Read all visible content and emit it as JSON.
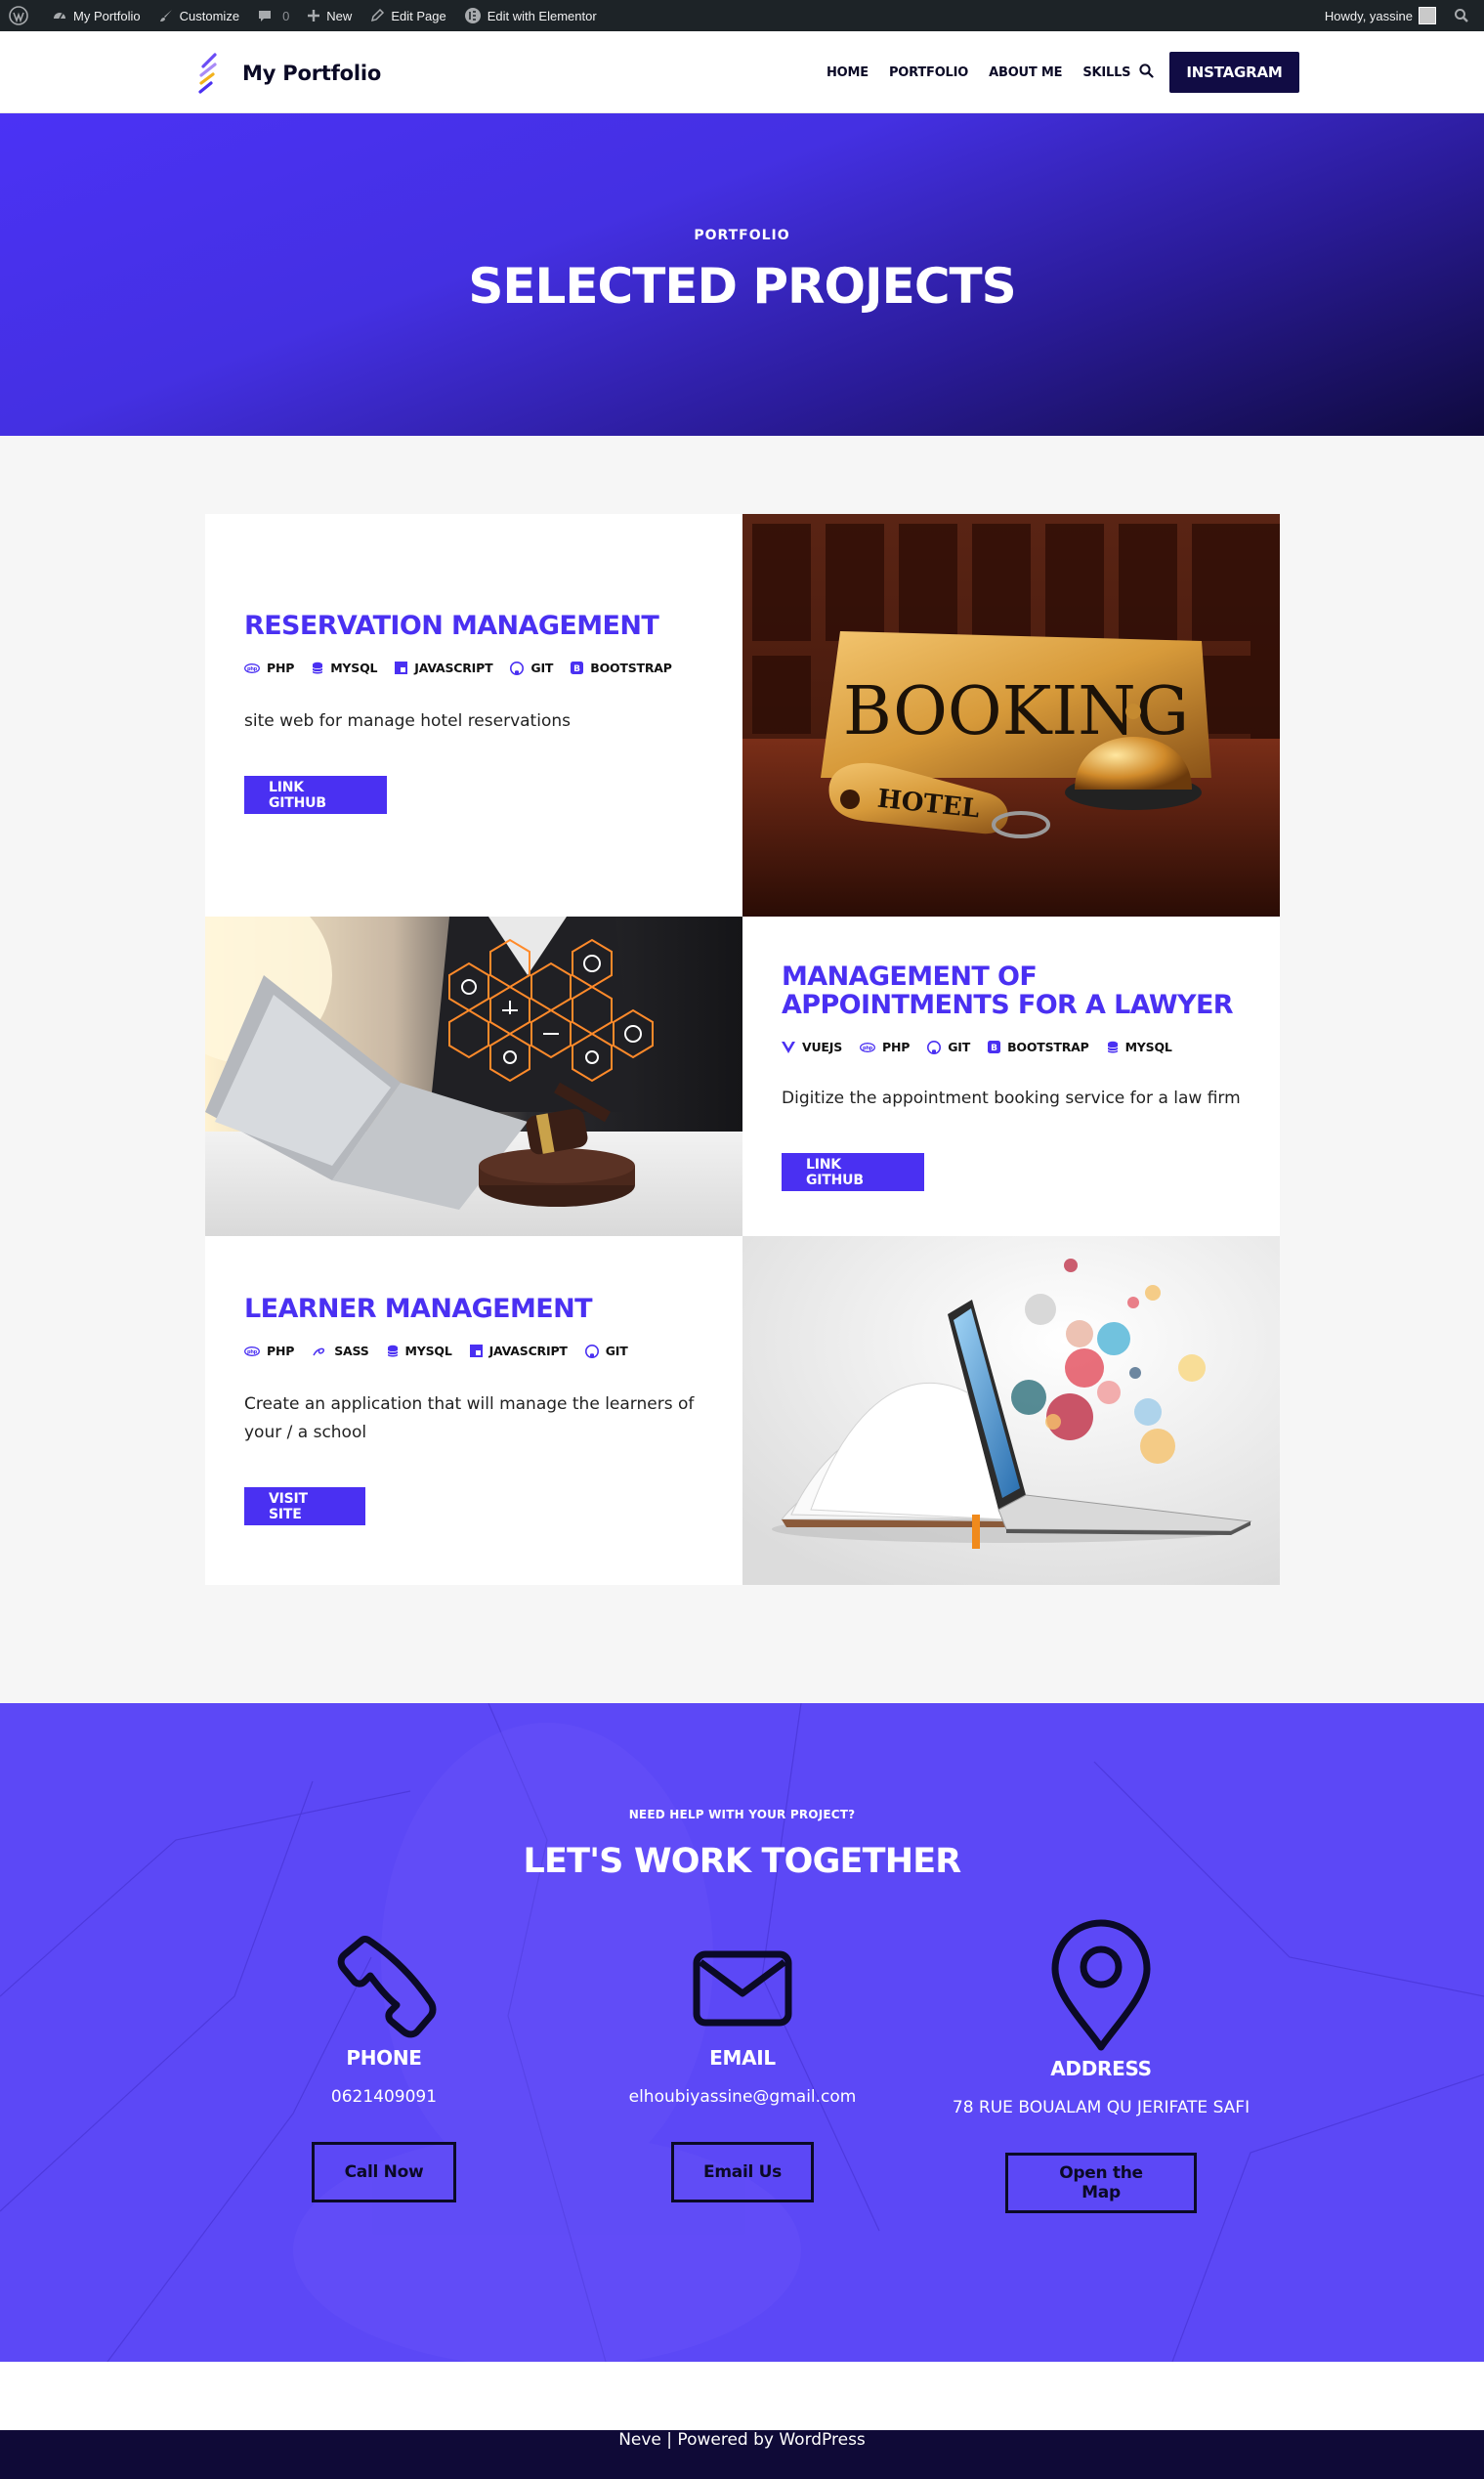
{
  "adminbar": {
    "site_name": "My Portfolio",
    "customize": "Customize",
    "comments_count": "0",
    "new": "New",
    "edit_page": "Edit Page",
    "elementor": "Edit with Elementor",
    "howdy": "Howdy, yassine"
  },
  "header": {
    "logo_text": "My Portfolio",
    "nav": [
      "HOME",
      "PORTFOLIO",
      "ABOUT ME",
      "SKILLS"
    ],
    "cta": "INSTAGRAM"
  },
  "hero": {
    "kicker": "PORTFOLIO",
    "title": "SELECTED PROJECTS"
  },
  "projects": [
    {
      "title": "RESERVATION MANAGEMENT",
      "tags": [
        "PHP",
        "MYSQL",
        "JAVASCRIPT",
        "GIT",
        "BOOTSTRAP"
      ],
      "description": "site web for manage hotel reservations",
      "button": "LINK GITHUB"
    },
    {
      "title_line1": "MANAGEMENT OF",
      "title_line2": "APPOINTMENTS FOR A LAWYER",
      "tags": [
        "VUEJS",
        "PHP",
        "GIT",
        "BOOTSTRAP",
        "MYSQL"
      ],
      "description": "Digitize the appointment booking service for a law firm",
      "button": "LINK GITHUB"
    },
    {
      "title": "LEARNER MANAGEMENT",
      "tags": [
        "PHP",
        "SASS",
        "MYSQL",
        "JAVASCRIPT",
        "GIT"
      ],
      "description_line1": "Create an application that will manage the learners of",
      "description_line2": "your / a school",
      "button": "VISIT SITE"
    }
  ],
  "images": {
    "booking_sign": "BOOKING",
    "hotel_tag": "HOTEL"
  },
  "contact": {
    "kicker": "NEED HELP WITH YOUR PROJECT?",
    "title": "LET'S WORK TOGETHER",
    "phone": {
      "label": "PHONE",
      "value": "0621409091",
      "button": "Call Now"
    },
    "email": {
      "label": "EMAIL",
      "value": "elhoubiyassine@gmail.com",
      "button": "Email Us"
    },
    "address": {
      "label": "ADDRESS",
      "value": "78 RUE BOUALAM QU JERIFATE SAFI",
      "button": "Open the Map"
    }
  },
  "footer": {
    "text": "Neve | Powered by WordPress"
  },
  "colors": {
    "accent": "#4a30f2",
    "dark": "#0b0a26",
    "contact_bg": "#5c48f6",
    "footer_bg": "#0f0a37"
  }
}
